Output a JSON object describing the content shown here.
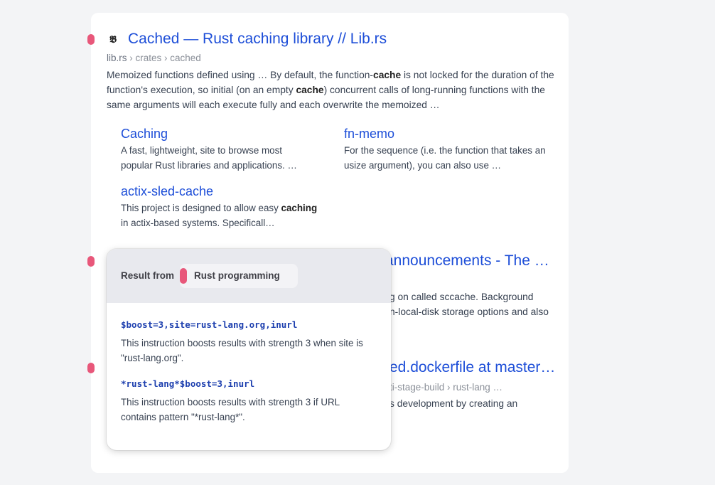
{
  "results": [
    {
      "favicon": "𝕭",
      "title": "Cached — Rust caching library // Lib.rs",
      "breadcrumb": {
        "domain": "lib.rs",
        "path": " › crates › cached"
      },
      "snippet_parts": [
        "Memoized functions defined using … By default, the function-",
        "cache",
        " is not locked for the duration of the function's execution, so initial (on an empty ",
        "cache",
        ") concurrent calls of long-running functions with the same arguments will each execute fully and each overwrite the memoized …"
      ],
      "sublinks": [
        {
          "title": "Caching",
          "desc": "A fast, lightweight, site to browse most popular Rust libraries and applications. …"
        },
        {
          "title": "fn-memo",
          "desc": "For the sequence (i.e. the function that takes an usize argument), you can also use …"
        },
        {
          "title": "actix-sled-cache",
          "desc_pre": "This project is designed to allow easy ",
          "desc_bold": "caching",
          "desc_post": " in actix-based systems. Specificall…"
        }
      ]
    },
    {
      "title_visible": "announcements - The …",
      "snippet_line1": "g on called sccache. Background",
      "snippet_line2": "n-local-disk storage options and also"
    },
    {
      "title_visible": "ed.dockerfile at master…",
      "breadcrumb_visible": "ti-stage-build › rust-lang …",
      "snippet_line1": "s development by creating an"
    }
  ],
  "popover": {
    "header_label": "Result from",
    "chip_label": "Rust programming",
    "rules": [
      {
        "code": "$boost=3,site=rust-lang.org,inurl",
        "desc": "This instruction boosts results with strength 3 when site is \"rust-lang.org\"."
      },
      {
        "code": "*rust-lang*$boost=3,inurl",
        "desc": "This instruction boosts results with strength 3 if URL contains pattern \"*rust-lang*\"."
      }
    ]
  },
  "colors": {
    "accent_marker": "#e8577a",
    "link": "#1d4ed8",
    "code": "#1e40af"
  }
}
